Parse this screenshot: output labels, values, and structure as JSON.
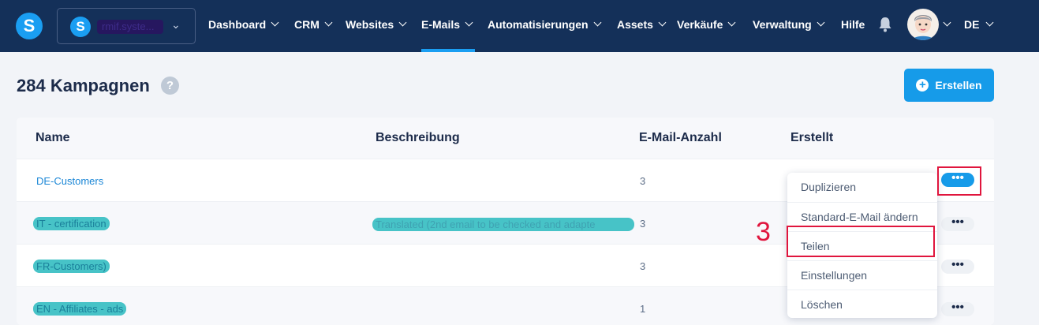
{
  "brand": {
    "logo_letter": "S",
    "account_name": "rmif.syste..."
  },
  "nav": {
    "items": [
      "Dashboard",
      "CRM",
      "Websites",
      "E-Mails",
      "Automatisierungen",
      "Assets",
      "Verkäufe",
      "Verwaltung",
      "Hilfe"
    ],
    "active": "E-Mails",
    "language": "DE"
  },
  "header": {
    "count": "284",
    "title": "Kampagnen",
    "help": "?",
    "create_label": "Erstellen"
  },
  "table": {
    "columns": [
      "Name",
      "Beschreibung",
      "E-Mail-Anzahl",
      "Erstellt"
    ],
    "rows": [
      {
        "name": "DE-Customers",
        "description": "",
        "emails": "3"
      },
      {
        "name": "IT - certification",
        "description": "Translated (2nd email to be checked and adapte",
        "emails": "3"
      },
      {
        "name": "FR-Customers)",
        "description": "",
        "emails": "3"
      },
      {
        "name": "EN - Affiliates - ads",
        "description": "",
        "emails": "1"
      }
    ],
    "row_action": "•••"
  },
  "menu": {
    "items": [
      "Duplizieren",
      "Standard-E-Mail ändern",
      "Teilen",
      "Einstellungen",
      "Löschen"
    ]
  },
  "annotation": {
    "step": "3"
  },
  "colors": {
    "nav_bg": "#143059",
    "accent": "#169be9",
    "highlight": "#47c3c7",
    "marker": "#e0153d"
  }
}
